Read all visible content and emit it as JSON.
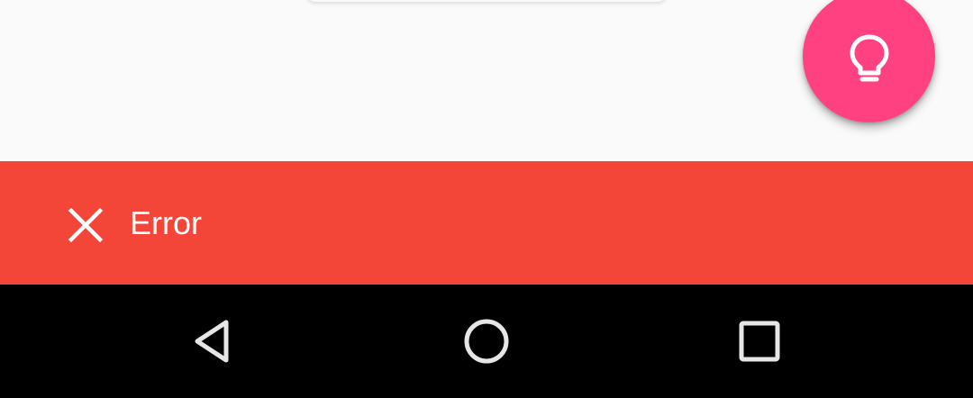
{
  "fab": {
    "icon": "lightbulb-icon",
    "color": "#ff4081"
  },
  "snackbar": {
    "message": "Error",
    "icon": "close-icon",
    "background": "#f44539"
  },
  "navigation_bar": {
    "buttons": [
      {
        "icon": "back-triangle-icon"
      },
      {
        "icon": "home-circle-icon"
      },
      {
        "icon": "recents-square-icon"
      }
    ]
  }
}
